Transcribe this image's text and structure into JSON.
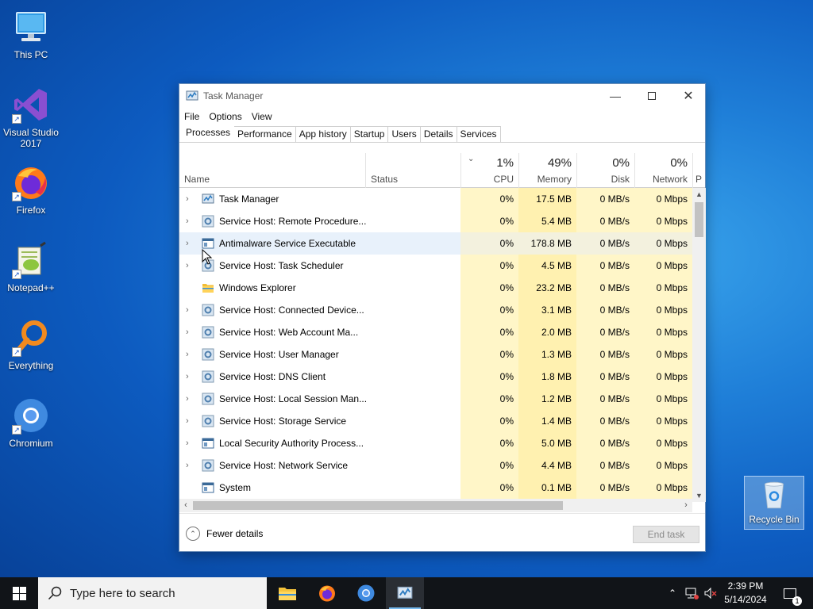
{
  "desktop": {
    "icons": [
      {
        "label": "This PC"
      },
      {
        "label": "Visual Studio 2017"
      },
      {
        "label": "Firefox"
      },
      {
        "label": "Notepad++"
      },
      {
        "label": "Everything"
      },
      {
        "label": "Chromium"
      }
    ],
    "recycle_bin": {
      "label": "Recycle Bin"
    }
  },
  "task_manager": {
    "title": "Task Manager",
    "menu": [
      "File",
      "Options",
      "View"
    ],
    "tabs": [
      "Processes",
      "Performance",
      "App history",
      "Startup",
      "Users",
      "Details",
      "Services"
    ],
    "active_tab": "Processes",
    "columns": {
      "name": "Name",
      "status": "Status",
      "cpu": {
        "percent": "1%",
        "label": "CPU"
      },
      "memory": {
        "percent": "49%",
        "label": "Memory"
      },
      "disk": {
        "percent": "0%",
        "label": "Disk"
      },
      "network": {
        "percent": "0%",
        "label": "Network"
      },
      "power_partial": "P"
    },
    "processes": [
      {
        "name": "Task Manager",
        "cpu": "0%",
        "memory": "17.5 MB",
        "disk": "0 MB/s",
        "network": "0 Mbps",
        "expandable": true,
        "icon": "taskmgr-icon"
      },
      {
        "name": "Service Host: Remote Procedure...",
        "cpu": "0%",
        "memory": "5.4 MB",
        "disk": "0 MB/s",
        "network": "0 Mbps",
        "expandable": true,
        "icon": "gear-icon"
      },
      {
        "name": "Antimalware Service Executable",
        "cpu": "0%",
        "memory": "178.8 MB",
        "disk": "0 MB/s",
        "network": "0 Mbps",
        "expandable": true,
        "icon": "window-icon"
      },
      {
        "name": "Service Host: Task Scheduler",
        "cpu": "0%",
        "memory": "4.5 MB",
        "disk": "0 MB/s",
        "network": "0 Mbps",
        "expandable": true,
        "icon": "gear-icon"
      },
      {
        "name": "Windows Explorer",
        "cpu": "0%",
        "memory": "23.2 MB",
        "disk": "0 MB/s",
        "network": "0 Mbps",
        "expandable": false,
        "icon": "folder-icon"
      },
      {
        "name": "Service Host: Connected Device...",
        "cpu": "0%",
        "memory": "3.1 MB",
        "disk": "0 MB/s",
        "network": "0 Mbps",
        "expandable": true,
        "icon": "gear-icon"
      },
      {
        "name": "Service Host: Web Account Ma...",
        "cpu": "0%",
        "memory": "2.0 MB",
        "disk": "0 MB/s",
        "network": "0 Mbps",
        "expandable": true,
        "icon": "gear-icon"
      },
      {
        "name": "Service Host: User Manager",
        "cpu": "0%",
        "memory": "1.3 MB",
        "disk": "0 MB/s",
        "network": "0 Mbps",
        "expandable": true,
        "icon": "gear-icon"
      },
      {
        "name": "Service Host: DNS Client",
        "cpu": "0%",
        "memory": "1.8 MB",
        "disk": "0 MB/s",
        "network": "0 Mbps",
        "expandable": true,
        "icon": "gear-icon"
      },
      {
        "name": "Service Host: Local Session Man...",
        "cpu": "0%",
        "memory": "1.2 MB",
        "disk": "0 MB/s",
        "network": "0 Mbps",
        "expandable": true,
        "icon": "gear-icon"
      },
      {
        "name": "Service Host: Storage Service",
        "cpu": "0%",
        "memory": "1.4 MB",
        "disk": "0 MB/s",
        "network": "0 Mbps",
        "expandable": true,
        "icon": "gear-icon"
      },
      {
        "name": "Local Security Authority Process...",
        "cpu": "0%",
        "memory": "5.0 MB",
        "disk": "0 MB/s",
        "network": "0 Mbps",
        "expandable": true,
        "icon": "window-icon"
      },
      {
        "name": "Service Host: Network Service",
        "cpu": "0%",
        "memory": "4.4 MB",
        "disk": "0 MB/s",
        "network": "0 Mbps",
        "expandable": true,
        "icon": "gear-icon"
      },
      {
        "name": "System",
        "cpu": "0%",
        "memory": "0.1 MB",
        "disk": "0 MB/s",
        "network": "0 Mbps",
        "expandable": false,
        "icon": "window-icon"
      }
    ],
    "footer": {
      "fewer_details": "Fewer details",
      "end_task": "End task"
    }
  },
  "taskbar": {
    "search_placeholder": "Type here to search",
    "clock_time": "2:39 PM",
    "clock_date": "5/14/2024",
    "notification_count": "1"
  },
  "colors": {
    "cpu_col_bg": "#fff6c8",
    "memory_col_bg": "#fff1b0",
    "row_highlight": "#e8f1fb",
    "taskbar_bg": "#111418"
  }
}
